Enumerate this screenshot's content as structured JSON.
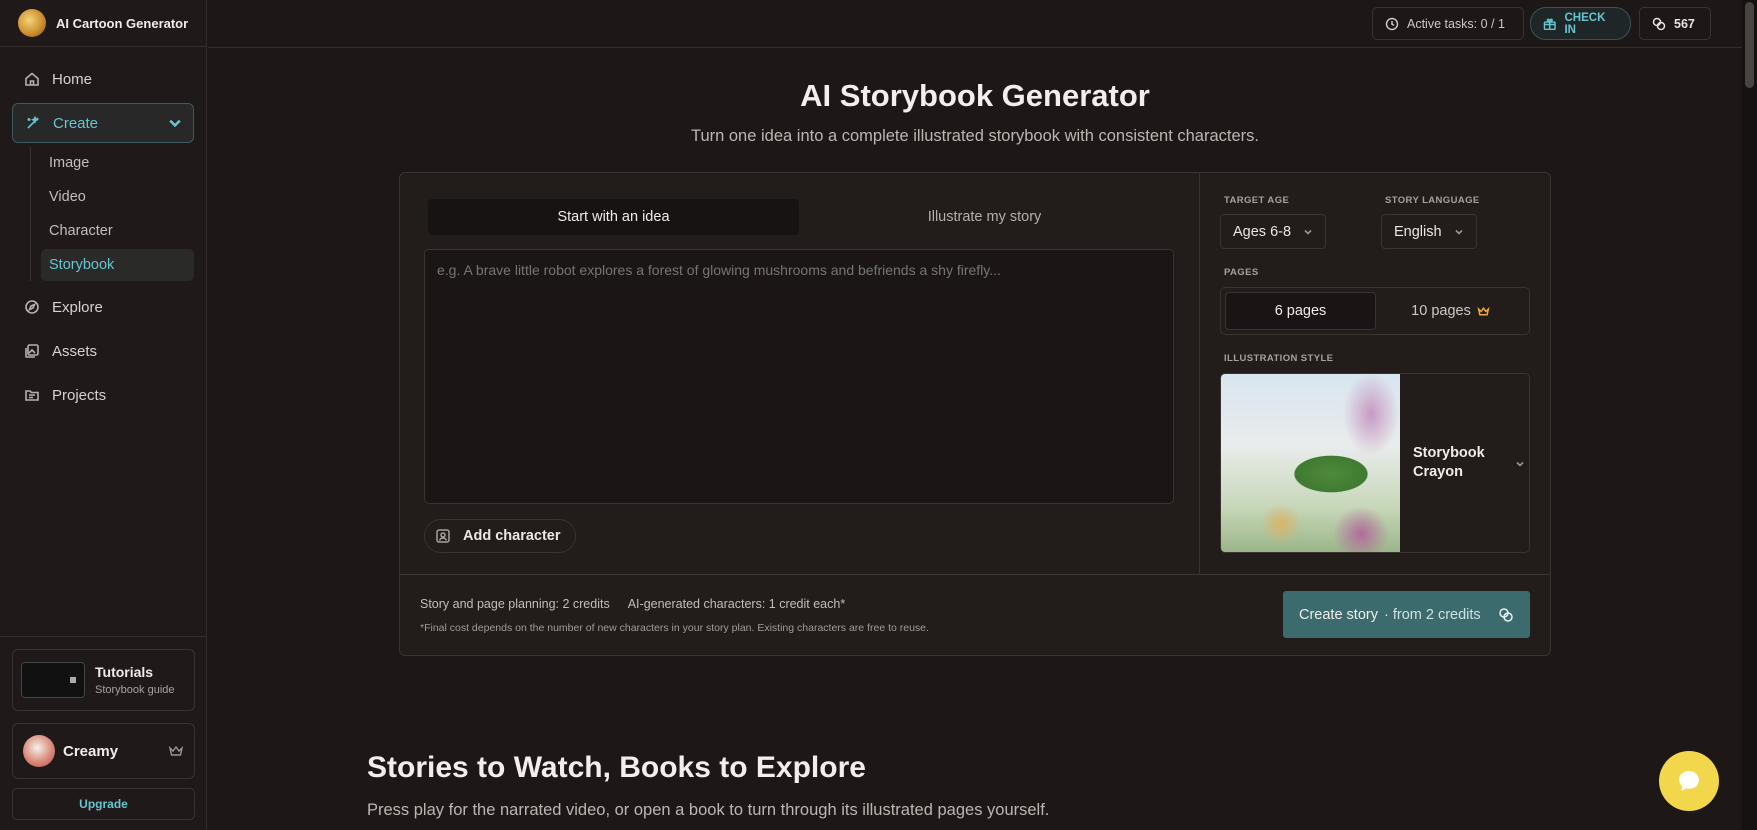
{
  "app": {
    "name": "AI Cartoon Generator"
  },
  "sidebar": {
    "items": [
      {
        "label": "Home",
        "icon": "home-icon"
      },
      {
        "label": "Create",
        "icon": "sparkle-icon"
      },
      {
        "label": "Explore",
        "icon": "compass-icon"
      },
      {
        "label": "Assets",
        "icon": "gallery-icon"
      },
      {
        "label": "Projects",
        "icon": "folder-icon"
      }
    ],
    "create_sub": [
      "Image",
      "Video",
      "Character",
      "Storybook"
    ],
    "active_sub": "Storybook",
    "tutorials": {
      "title": "Tutorials",
      "subtitle": "Storybook guide"
    },
    "user": {
      "name": "Creamy"
    },
    "upgrade_label": "Upgrade"
  },
  "topbar": {
    "active_tasks": "Active tasks: 0 / 1",
    "check_in": "CHECK IN",
    "credits": "567"
  },
  "main": {
    "title": "AI Storybook Generator",
    "subtitle": "Turn one idea into a complete illustrated storybook with consistent characters.",
    "tabs": [
      "Start with an idea",
      "Illustrate my story"
    ],
    "idea_placeholder": "e.g. A brave little robot explores a forest of glowing mushrooms and befriends a shy firefly...",
    "add_character": "Add character",
    "target_age": {
      "label": "TARGET AGE",
      "value": "Ages 6-8"
    },
    "story_language": {
      "label": "STORY LANGUAGE",
      "value": "English"
    },
    "pages": {
      "label": "PAGES",
      "options": [
        "6 pages",
        "10 pages"
      ],
      "selected": "6 pages"
    },
    "illustration_style": {
      "label": "ILLUSTRATION STYLE",
      "value_line1": "Storybook",
      "value_line2": "Crayon"
    },
    "cost": {
      "planning": "Story and page planning: 2 credits",
      "characters": "AI-generated characters: 1 credit each*",
      "note": "*Final cost depends on the number of new characters in your story plan. Existing characters are free to reuse."
    },
    "create_button": {
      "label": "Create story",
      "from": "· from 2 credits"
    }
  },
  "section": {
    "title": "Stories to Watch, Books to Explore",
    "subtitle": "Press play for the narrated video, or open a book to turn through its illustrated pages yourself."
  },
  "colors": {
    "accent": "#67c5d0",
    "create_button": "#3c6b6e",
    "chat": "#f2d64b"
  }
}
